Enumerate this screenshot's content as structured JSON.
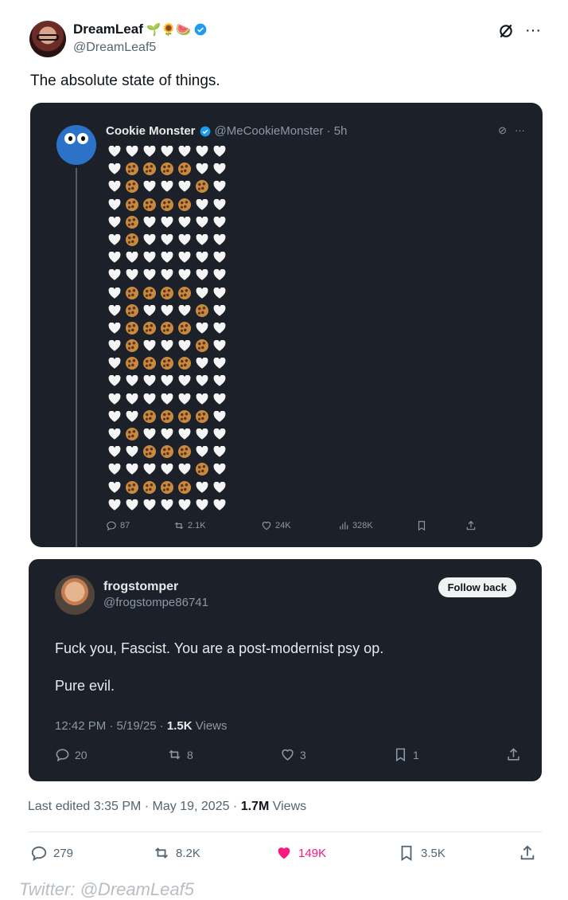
{
  "post": {
    "author_name": "DreamLeaf",
    "author_emojis": "🌱🌻🍉",
    "author_handle": "@DreamLeaf5",
    "text": "The absolute state of things."
  },
  "quoted_tweet": {
    "name": "Cookie Monster",
    "handle_time": "@MeCookieMonster · 5h",
    "emoji_grid": [
      "HHHHHHH",
      "HCCCCHH",
      "HCHHHCH",
      "HCCCCHH",
      "HCHHHHH",
      "HCHHHHH",
      "HHHHHHH",
      "HHHHHHH",
      "HCCCCHH",
      "HCHHHCH",
      "HCCCCHH",
      "HCHHHCH",
      "HCCCCHH",
      "HHHHHHH",
      "HHHHHHH",
      "HHCCCCH",
      "HCHHHHH",
      "HHCCCHH",
      "HHHHHCH",
      "HCCCCHH",
      "HHHHHHH"
    ],
    "replies": "87",
    "reposts": "2.1K",
    "likes": "24K",
    "views": "328K"
  },
  "reply_tweet": {
    "name": "frogstomper",
    "handle": "@frogstompe86741",
    "follow_label": "Follow back",
    "text_line1": "Fuck you, Fascist. You are a post-modernist psy op.",
    "text_line2": "Pure evil.",
    "timestamp": "12:42 PM · 5/19/25 · ",
    "views_count": "1.5K",
    "views_label": " Views",
    "replies": "20",
    "reposts": "8",
    "likes": "3",
    "bookmarks": "1"
  },
  "footer": {
    "edited_prefix": "Last edited 3:35 PM · May 19, 2025 · ",
    "views_count": "1.7M",
    "views_label": " Views",
    "replies": "279",
    "reposts": "8.2K",
    "likes": "149K",
    "bookmarks": "3.5K"
  },
  "watermark": "Twitter: @DreamLeaf5",
  "colors": {
    "like_active": "#f91880",
    "verified": "#1d9bf0",
    "card_bg": "#1c2129"
  }
}
